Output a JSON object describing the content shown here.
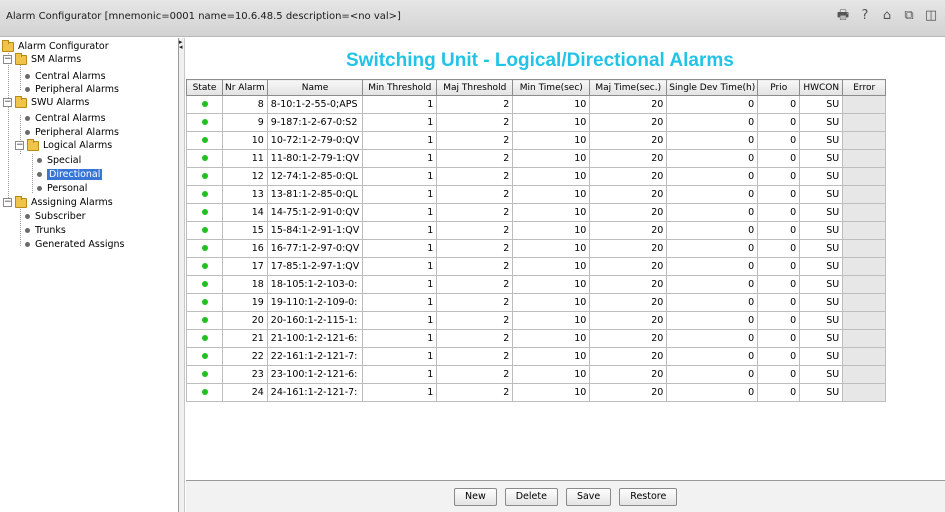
{
  "window": {
    "title": "Alarm Configurator [mnemonic=0001 name=10.6.48.5 description=<no val>]",
    "tools": [
      "print-icon",
      "help-icon",
      "home-icon",
      "exit-icon",
      "detach-icon"
    ]
  },
  "tree": {
    "root": "Alarm Configurator",
    "sm_alarms": "SM Alarms",
    "sm_central": "Central Alarms",
    "sm_peripheral": "Peripheral Alarms",
    "swu_alarms": "SWU Alarms",
    "swu_central": "Central Alarms",
    "swu_peripheral": "Peripheral Alarms",
    "logical": "Logical Alarms",
    "special": "Special",
    "directional": "Directional",
    "personal": "Personal",
    "assigning": "Assigning Alarms",
    "subscriber": "Subscriber",
    "trunks": "Trunks",
    "generated": "Generated Assigns",
    "expand_minus": "−"
  },
  "page_title": "Switching Unit - Logical/Directional Alarms",
  "table": {
    "headers": {
      "state": "State",
      "nr": "Nr Alarm",
      "name": "Name",
      "min_thr": "Min Threshold",
      "maj_thr": "Maj Threshold",
      "min_time": "Min Time(sec)",
      "maj_time": "Maj Time(sec.)",
      "single_dev": "Single Dev Time(h)",
      "prio": "Prio",
      "hwcon": "HWCON",
      "error": "Error"
    },
    "state_color": "#20c020",
    "rows": [
      {
        "nr": "8",
        "name": "8-10:1-2-55-0;APS",
        "min_thr": "1",
        "maj_thr": "2",
        "min_time": "10",
        "maj_time": "20",
        "single_dev": "0",
        "prio": "0",
        "hwcon": "SU",
        "error": ""
      },
      {
        "nr": "9",
        "name": "9-187:1-2-67-0:S2",
        "min_thr": "1",
        "maj_thr": "2",
        "min_time": "10",
        "maj_time": "20",
        "single_dev": "0",
        "prio": "0",
        "hwcon": "SU",
        "error": ""
      },
      {
        "nr": "10",
        "name": "10-72:1-2-79-0:QV",
        "min_thr": "1",
        "maj_thr": "2",
        "min_time": "10",
        "maj_time": "20",
        "single_dev": "0",
        "prio": "0",
        "hwcon": "SU",
        "error": ""
      },
      {
        "nr": "11",
        "name": "11-80:1-2-79-1:QV",
        "min_thr": "1",
        "maj_thr": "2",
        "min_time": "10",
        "maj_time": "20",
        "single_dev": "0",
        "prio": "0",
        "hwcon": "SU",
        "error": ""
      },
      {
        "nr": "12",
        "name": "12-74:1-2-85-0:QL",
        "min_thr": "1",
        "maj_thr": "2",
        "min_time": "10",
        "maj_time": "20",
        "single_dev": "0",
        "prio": "0",
        "hwcon": "SU",
        "error": ""
      },
      {
        "nr": "13",
        "name": "13-81:1-2-85-0:QL",
        "min_thr": "1",
        "maj_thr": "2",
        "min_time": "10",
        "maj_time": "20",
        "single_dev": "0",
        "prio": "0",
        "hwcon": "SU",
        "error": ""
      },
      {
        "nr": "14",
        "name": "14-75:1-2-91-0:QV",
        "min_thr": "1",
        "maj_thr": "2",
        "min_time": "10",
        "maj_time": "20",
        "single_dev": "0",
        "prio": "0",
        "hwcon": "SU",
        "error": ""
      },
      {
        "nr": "15",
        "name": "15-84:1-2-91-1:QV",
        "min_thr": "1",
        "maj_thr": "2",
        "min_time": "10",
        "maj_time": "20",
        "single_dev": "0",
        "prio": "0",
        "hwcon": "SU",
        "error": ""
      },
      {
        "nr": "16",
        "name": "16-77:1-2-97-0:QV",
        "min_thr": "1",
        "maj_thr": "2",
        "min_time": "10",
        "maj_time": "20",
        "single_dev": "0",
        "prio": "0",
        "hwcon": "SU",
        "error": ""
      },
      {
        "nr": "17",
        "name": "17-85:1-2-97-1:QV",
        "min_thr": "1",
        "maj_thr": "2",
        "min_time": "10",
        "maj_time": "20",
        "single_dev": "0",
        "prio": "0",
        "hwcon": "SU",
        "error": ""
      },
      {
        "nr": "18",
        "name": "18-105:1-2-103-0:",
        "min_thr": "1",
        "maj_thr": "2",
        "min_time": "10",
        "maj_time": "20",
        "single_dev": "0",
        "prio": "0",
        "hwcon": "SU",
        "error": ""
      },
      {
        "nr": "19",
        "name": "19-110:1-2-109-0:",
        "min_thr": "1",
        "maj_thr": "2",
        "min_time": "10",
        "maj_time": "20",
        "single_dev": "0",
        "prio": "0",
        "hwcon": "SU",
        "error": ""
      },
      {
        "nr": "20",
        "name": "20-160:1-2-115-1:",
        "min_thr": "1",
        "maj_thr": "2",
        "min_time": "10",
        "maj_time": "20",
        "single_dev": "0",
        "prio": "0",
        "hwcon": "SU",
        "error": ""
      },
      {
        "nr": "21",
        "name": "21-100:1-2-121-6:",
        "min_thr": "1",
        "maj_thr": "2",
        "min_time": "10",
        "maj_time": "20",
        "single_dev": "0",
        "prio": "0",
        "hwcon": "SU",
        "error": ""
      },
      {
        "nr": "22",
        "name": "22-161:1-2-121-7:",
        "min_thr": "1",
        "maj_thr": "2",
        "min_time": "10",
        "maj_time": "20",
        "single_dev": "0",
        "prio": "0",
        "hwcon": "SU",
        "error": ""
      },
      {
        "nr": "23",
        "name": "23-100:1-2-121-6:",
        "min_thr": "1",
        "maj_thr": "2",
        "min_time": "10",
        "maj_time": "20",
        "single_dev": "0",
        "prio": "0",
        "hwcon": "SU",
        "error": ""
      },
      {
        "nr": "24",
        "name": "24-161:1-2-121-7:",
        "min_thr": "1",
        "maj_thr": "2",
        "min_time": "10",
        "maj_time": "20",
        "single_dev": "0",
        "prio": "0",
        "hwcon": "SU",
        "error": ""
      }
    ]
  },
  "buttons": {
    "new": "New",
    "delete": "Delete",
    "save": "Save",
    "restore": "Restore"
  }
}
